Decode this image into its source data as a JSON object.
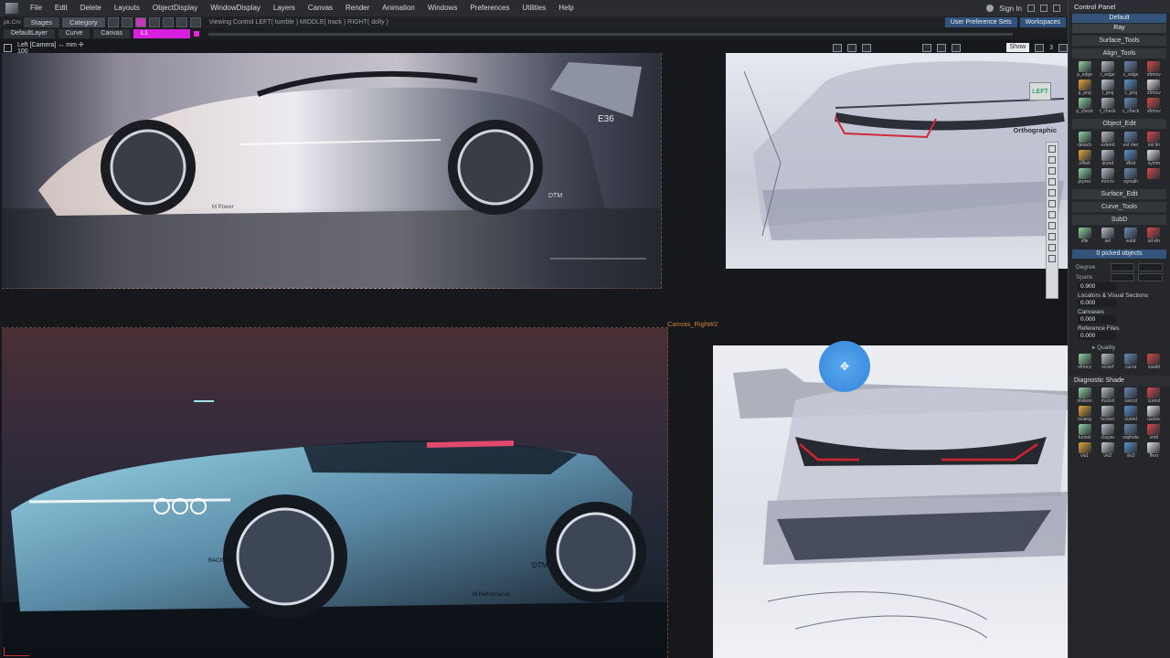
{
  "menubar": {
    "items": [
      "File",
      "Edit",
      "Delete",
      "Layouts",
      "ObjectDisplay",
      "WindowDisplay",
      "Layers",
      "Canvas",
      "Render",
      "Animation",
      "Windows",
      "Preferences",
      "Utilities",
      "Help"
    ],
    "sign_in": "Sign In"
  },
  "shelf": {
    "prefix": "pk.Crv",
    "tabs": [
      "Stages",
      "Category"
    ],
    "viewing_control": "Viewing Control   LEFT( tumble )   MIDDLE( track )   RIGHT( dolly )",
    "user_prefs": "User Preference Sets",
    "workspaces": "Workspaces"
  },
  "layerbar": {
    "default_layer": "DefaultLayer",
    "curve_tab": "Curve",
    "canvas_tab": "Canvas",
    "layer_l1": "L1"
  },
  "viewport": {
    "title": "Left [Camera]  ↔ mm   ✢ 100",
    "show_label": "Show",
    "view_count": "3"
  },
  "canvases": {
    "right_label": "Canvas_Right#2",
    "left_badge": "LEFT",
    "ortho_label": "Orthographic"
  },
  "car_texts": {
    "top_model": "E36",
    "top_brand": "M Power",
    "top_side": "DTM",
    "bottom_side": "DTM",
    "bottom_brand": "M Performance",
    "bottom_racing": "RACING"
  },
  "panel": {
    "title": "Control Panel",
    "preset_default": "Default",
    "preset_ray": "Ray",
    "surface_tools": "Surface_Tools",
    "align_tools": {
      "header": "Align_Tools",
      "tools": [
        "p_edge",
        "t_edge",
        "c_edge",
        "xfrmcv",
        "p_proj",
        "t_proj",
        "c_proj",
        "xfrmcv",
        "p_check",
        "t_check",
        "c_check",
        "xfrmcv"
      ]
    },
    "object_edit": {
      "header": "Object_Edit",
      "tools": [
        "detach",
        "extend",
        "ext mer",
        "ext lin",
        "offset",
        "qryed",
        "dhist",
        "symm",
        "prprec",
        "mrrcrv",
        "symalh",
        ""
      ]
    },
    "surface_edit": "Surface_Edit",
    "curve_tools": "Curve_Tools",
    "subd": {
      "header": "SubD",
      "tools": [
        "sfle",
        "sel",
        "subd",
        "sd eln"
      ]
    },
    "picked": "0 picked objects",
    "degree_label": "Degree",
    "spans_label": "Spans",
    "spans_val": "0.900",
    "locators_label": "Locators & Visual Sections",
    "locators_val": "0.000",
    "canvases_label": "Canvases",
    "canvases_val": "0.000",
    "reference_label": "Reference Files",
    "reference_val": "0.000",
    "quality": "Quality",
    "quality_tools": [
      "xfrmcv",
      "scnsrf",
      "curva",
      "xsedit"
    ],
    "diagnostic": {
      "header": "Diagnostic Shade",
      "tools": [
        "shdoon",
        "mulcol",
        "rancol",
        "curevl",
        "isoang",
        "horiver",
        "zureel",
        "useiec",
        "tunnel",
        "clayao",
        "sophote",
        "vmtl",
        "vis1",
        "vis2",
        "vis3",
        "ffext"
      ]
    }
  }
}
